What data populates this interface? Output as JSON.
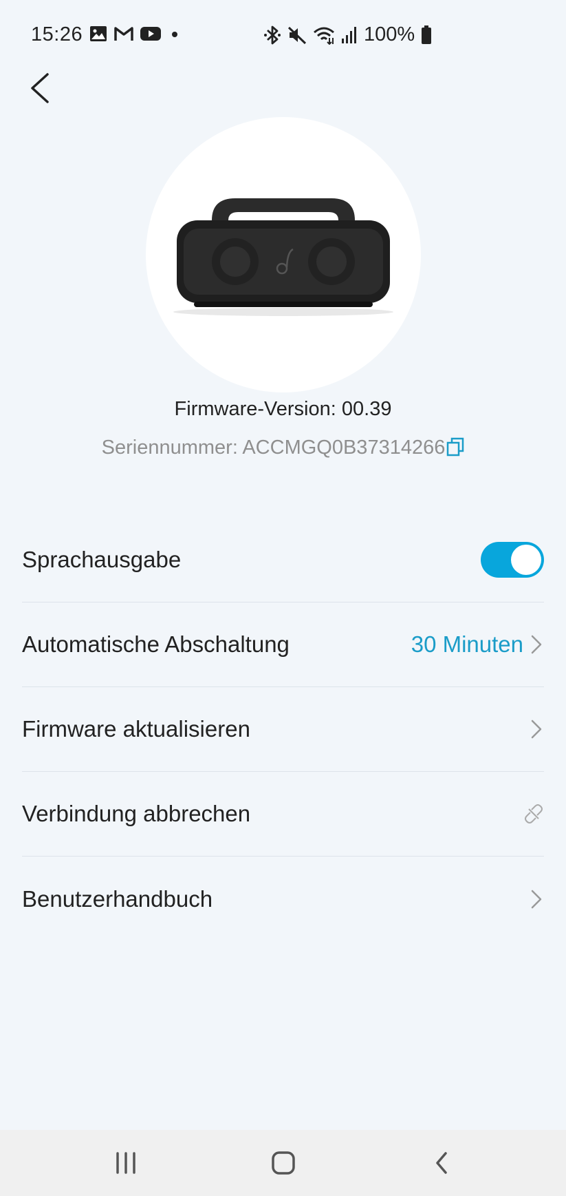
{
  "status_bar": {
    "time": "15:26",
    "battery": "100%",
    "left_icons": [
      "image-icon",
      "gmail-icon",
      "youtube-icon",
      "dot-icon"
    ],
    "right_icons": [
      "bluetooth-icon",
      "mute-icon",
      "wifi-icon",
      "signal-icon",
      "battery-icon"
    ]
  },
  "device": {
    "firmware": "Firmware-Version: 00.39",
    "serial": "Seriennummer: ACCMGQ0B37314266",
    "logo_text": "soundcore"
  },
  "settings": {
    "voice_prompt": {
      "label": "Sprachausgabe",
      "enabled": true
    },
    "auto_off": {
      "label": "Automatische Abschaltung",
      "value": "30 Minuten"
    },
    "firmware_update": {
      "label": "Firmware aktualisieren"
    },
    "disconnect": {
      "label": "Verbindung abbrechen"
    },
    "manual": {
      "label": "Benutzerhandbuch"
    }
  },
  "colors": {
    "background": "#f2f6fa",
    "accent": "#08a6dc",
    "value_text": "#1a9cc8",
    "secondary_text": "#8f8f8f"
  }
}
